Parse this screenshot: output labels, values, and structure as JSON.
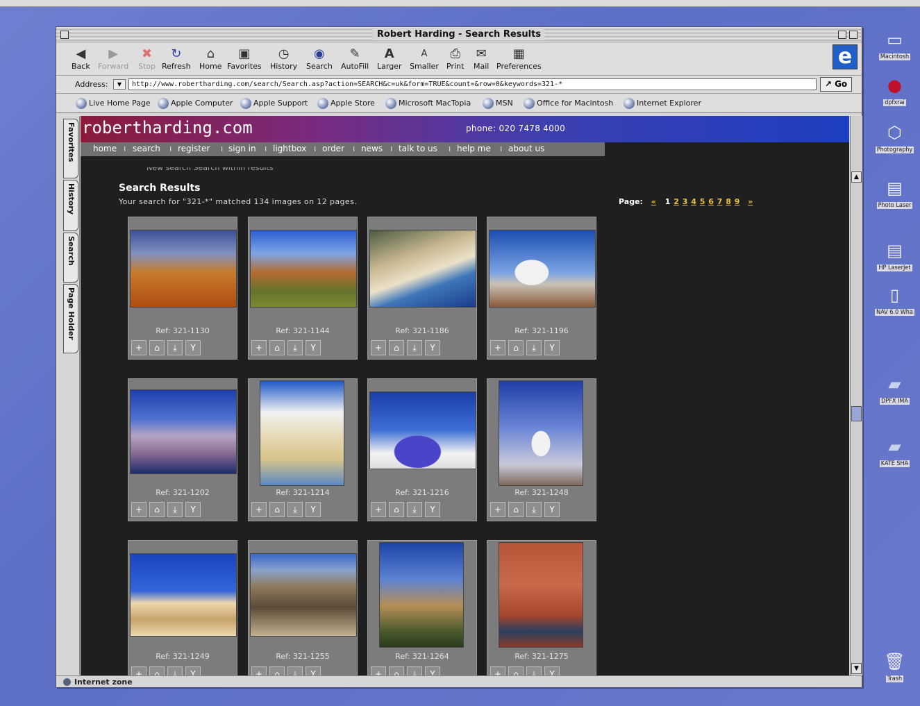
{
  "window": {
    "title": "Robert Harding - Search Results"
  },
  "toolbar": {
    "buttons": [
      {
        "label": "Back",
        "icon": "back-arrow-icon"
      },
      {
        "label": "Forward",
        "icon": "forward-arrow-icon"
      },
      {
        "label": "Stop",
        "icon": "stop-icon"
      },
      {
        "label": "Refresh",
        "icon": "refresh-icon"
      },
      {
        "label": "Home",
        "icon": "home-icon"
      },
      {
        "label": "Favorites",
        "icon": "favorites-icon"
      },
      {
        "label": "History",
        "icon": "history-icon"
      },
      {
        "label": "Search",
        "icon": "search-icon"
      },
      {
        "label": "AutoFill",
        "icon": "autofill-icon"
      },
      {
        "label": "Larger",
        "icon": "larger-text-icon"
      },
      {
        "label": "Smaller",
        "icon": "smaller-text-icon"
      },
      {
        "label": "Print",
        "icon": "print-icon"
      },
      {
        "label": "Mail",
        "icon": "mail-icon"
      },
      {
        "label": "Preferences",
        "icon": "preferences-icon"
      }
    ]
  },
  "address": {
    "label": "Address:",
    "url": "http://www.robertharding.com/search/Search.asp?action=SEARCH&c=uk&form=TRUE&count=&row=0&keywords=321-*",
    "go_label": "Go"
  },
  "favorites_bar": [
    "Live Home Page",
    "Apple Computer",
    "Apple Support",
    "Apple Store",
    "Microsoft MacTopia",
    "MSN",
    "Office for Macintosh",
    "Internet Explorer"
  ],
  "side_tabs": [
    "Favorites",
    "History",
    "Search",
    "Page Holder"
  ],
  "site": {
    "logo": "robertharding.com",
    "phone": "phone: 020 7478 4000",
    "nav": [
      "home",
      "search",
      "register",
      "sign in",
      "lightbox",
      "order",
      "news",
      "talk to us",
      "help me",
      "about us"
    ],
    "radio_options": "New search     Search within results"
  },
  "results": {
    "title": "Search Results",
    "summary": "Your search for \"321-*\" matched 134 images on 12 pages.",
    "page_label": "Page:",
    "prev": "«",
    "next": "»",
    "pages": [
      "1",
      "2",
      "3",
      "4",
      "5",
      "6",
      "7",
      "8",
      "9"
    ],
    "current_page": "1",
    "items": [
      {
        "ref": "Ref: 321-1130",
        "photo": "desert"
      },
      {
        "ref": "Ref: 321-1144",
        "photo": "mesa"
      },
      {
        "ref": "Ref: 321-1186",
        "photo": "beach"
      },
      {
        "ref": "Ref: 321-1196",
        "photo": "dome1"
      },
      {
        "ref": "Ref: 321-1202",
        "photo": "cliff"
      },
      {
        "ref": "Ref: 321-1214",
        "photo": "oia"
      },
      {
        "ref": "Ref: 321-1216",
        "photo": "bluedome"
      },
      {
        "ref": "Ref: 321-1248",
        "photo": "windmill"
      },
      {
        "ref": "Ref: 321-1249",
        "photo": "church"
      },
      {
        "ref": "Ref: 321-1255",
        "photo": "colonnade"
      },
      {
        "ref": "Ref: 321-1264",
        "photo": "fort"
      },
      {
        "ref": "Ref: 321-1275",
        "photo": "venice"
      }
    ],
    "actions": [
      "+",
      "⌂",
      "⤓",
      "Y"
    ]
  },
  "status": {
    "zone": "Internet zone"
  },
  "desktop_icons": [
    "Macintosh",
    "dpfxrai",
    "Photography",
    "Photo Laser",
    "HP LaserJet",
    "NAV 6.0 Wha",
    "DPFX IMA",
    "KATE SHA",
    "Trash"
  ]
}
